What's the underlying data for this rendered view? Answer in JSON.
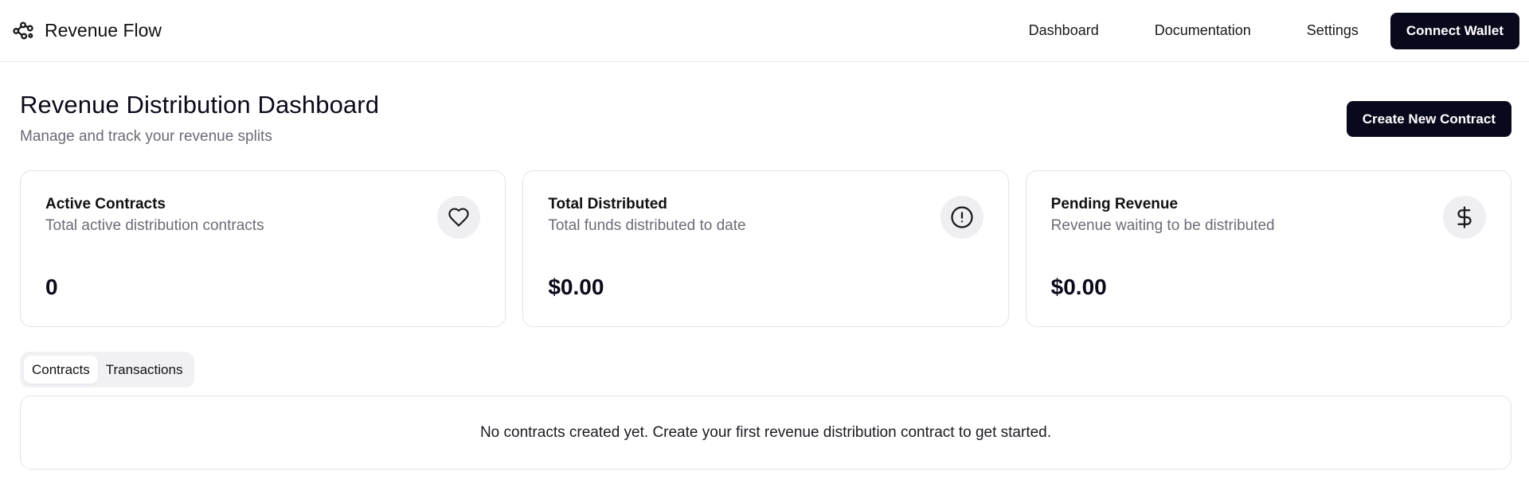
{
  "app": {
    "name": "Revenue Flow",
    "logo_icon": "network-icon"
  },
  "nav": {
    "links": [
      "Dashboard",
      "Documentation",
      "Settings"
    ],
    "connect_label": "Connect Wallet"
  },
  "page": {
    "title": "Revenue Distribution Dashboard",
    "subtitle": "Manage and track your revenue splits",
    "create_label": "Create New Contract"
  },
  "cards": [
    {
      "title": "Active Contracts",
      "desc": "Total active distribution contracts",
      "value": "0",
      "icon": "heart-icon"
    },
    {
      "title": "Total Distributed",
      "desc": "Total funds distributed to date",
      "value": "$0.00",
      "icon": "alert-circle-icon"
    },
    {
      "title": "Pending Revenue",
      "desc": "Revenue waiting to be distributed",
      "value": "$0.00",
      "icon": "dollar-icon"
    }
  ],
  "tabs": [
    "Contracts",
    "Transactions"
  ],
  "empty_message": "No contracts created yet. Create your first revenue distribution contract to get started.",
  "colors": {
    "primary": "#09091c",
    "muted_text": "#6b6b76",
    "icon_bg": "#efeff2"
  }
}
